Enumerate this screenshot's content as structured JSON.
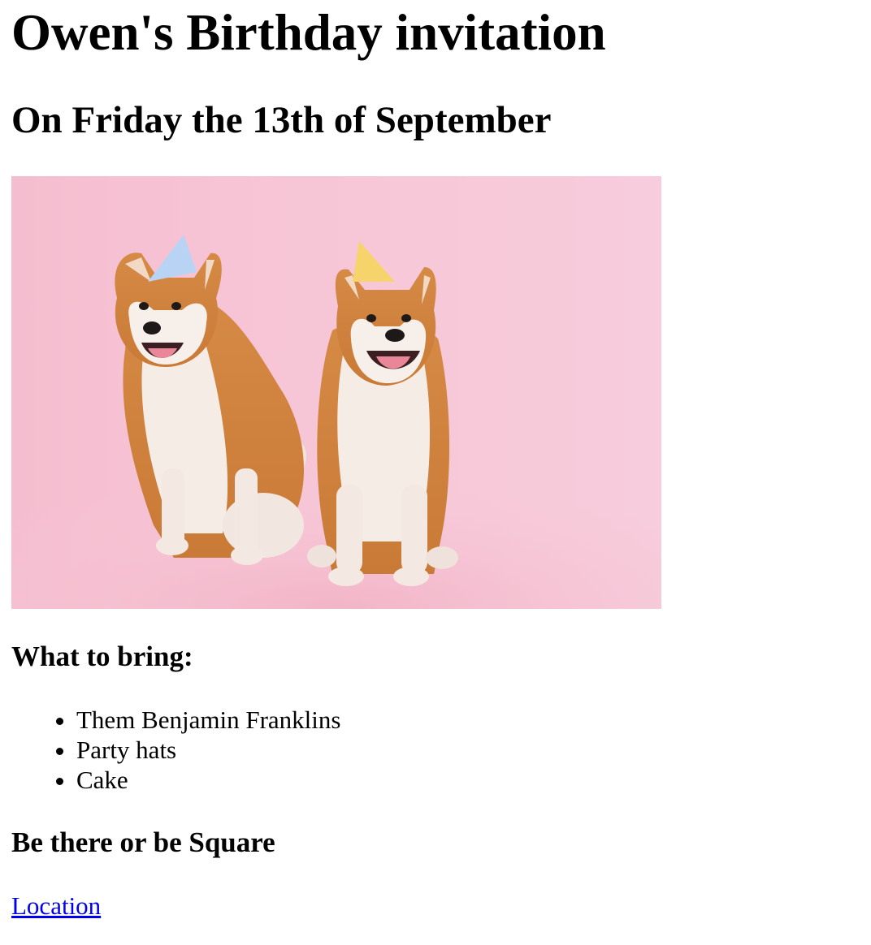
{
  "title": "Owen's Birthday invitation",
  "subtitle": "On Friday the 13th of September",
  "photo": {
    "icon": "two-shiba-inu-dogs-with-party-hats-photo",
    "background_color": "#f7c6d6",
    "hat_colors": [
      "#b9d3f5",
      "#f6d36b"
    ]
  },
  "bring": {
    "heading": "What to bring:",
    "items": [
      "Them Benjamin Franklins",
      "Party hats",
      "Cake"
    ]
  },
  "closing": "Be there or be Square",
  "location_link": {
    "label": "Location",
    "color": "#0000ee"
  }
}
